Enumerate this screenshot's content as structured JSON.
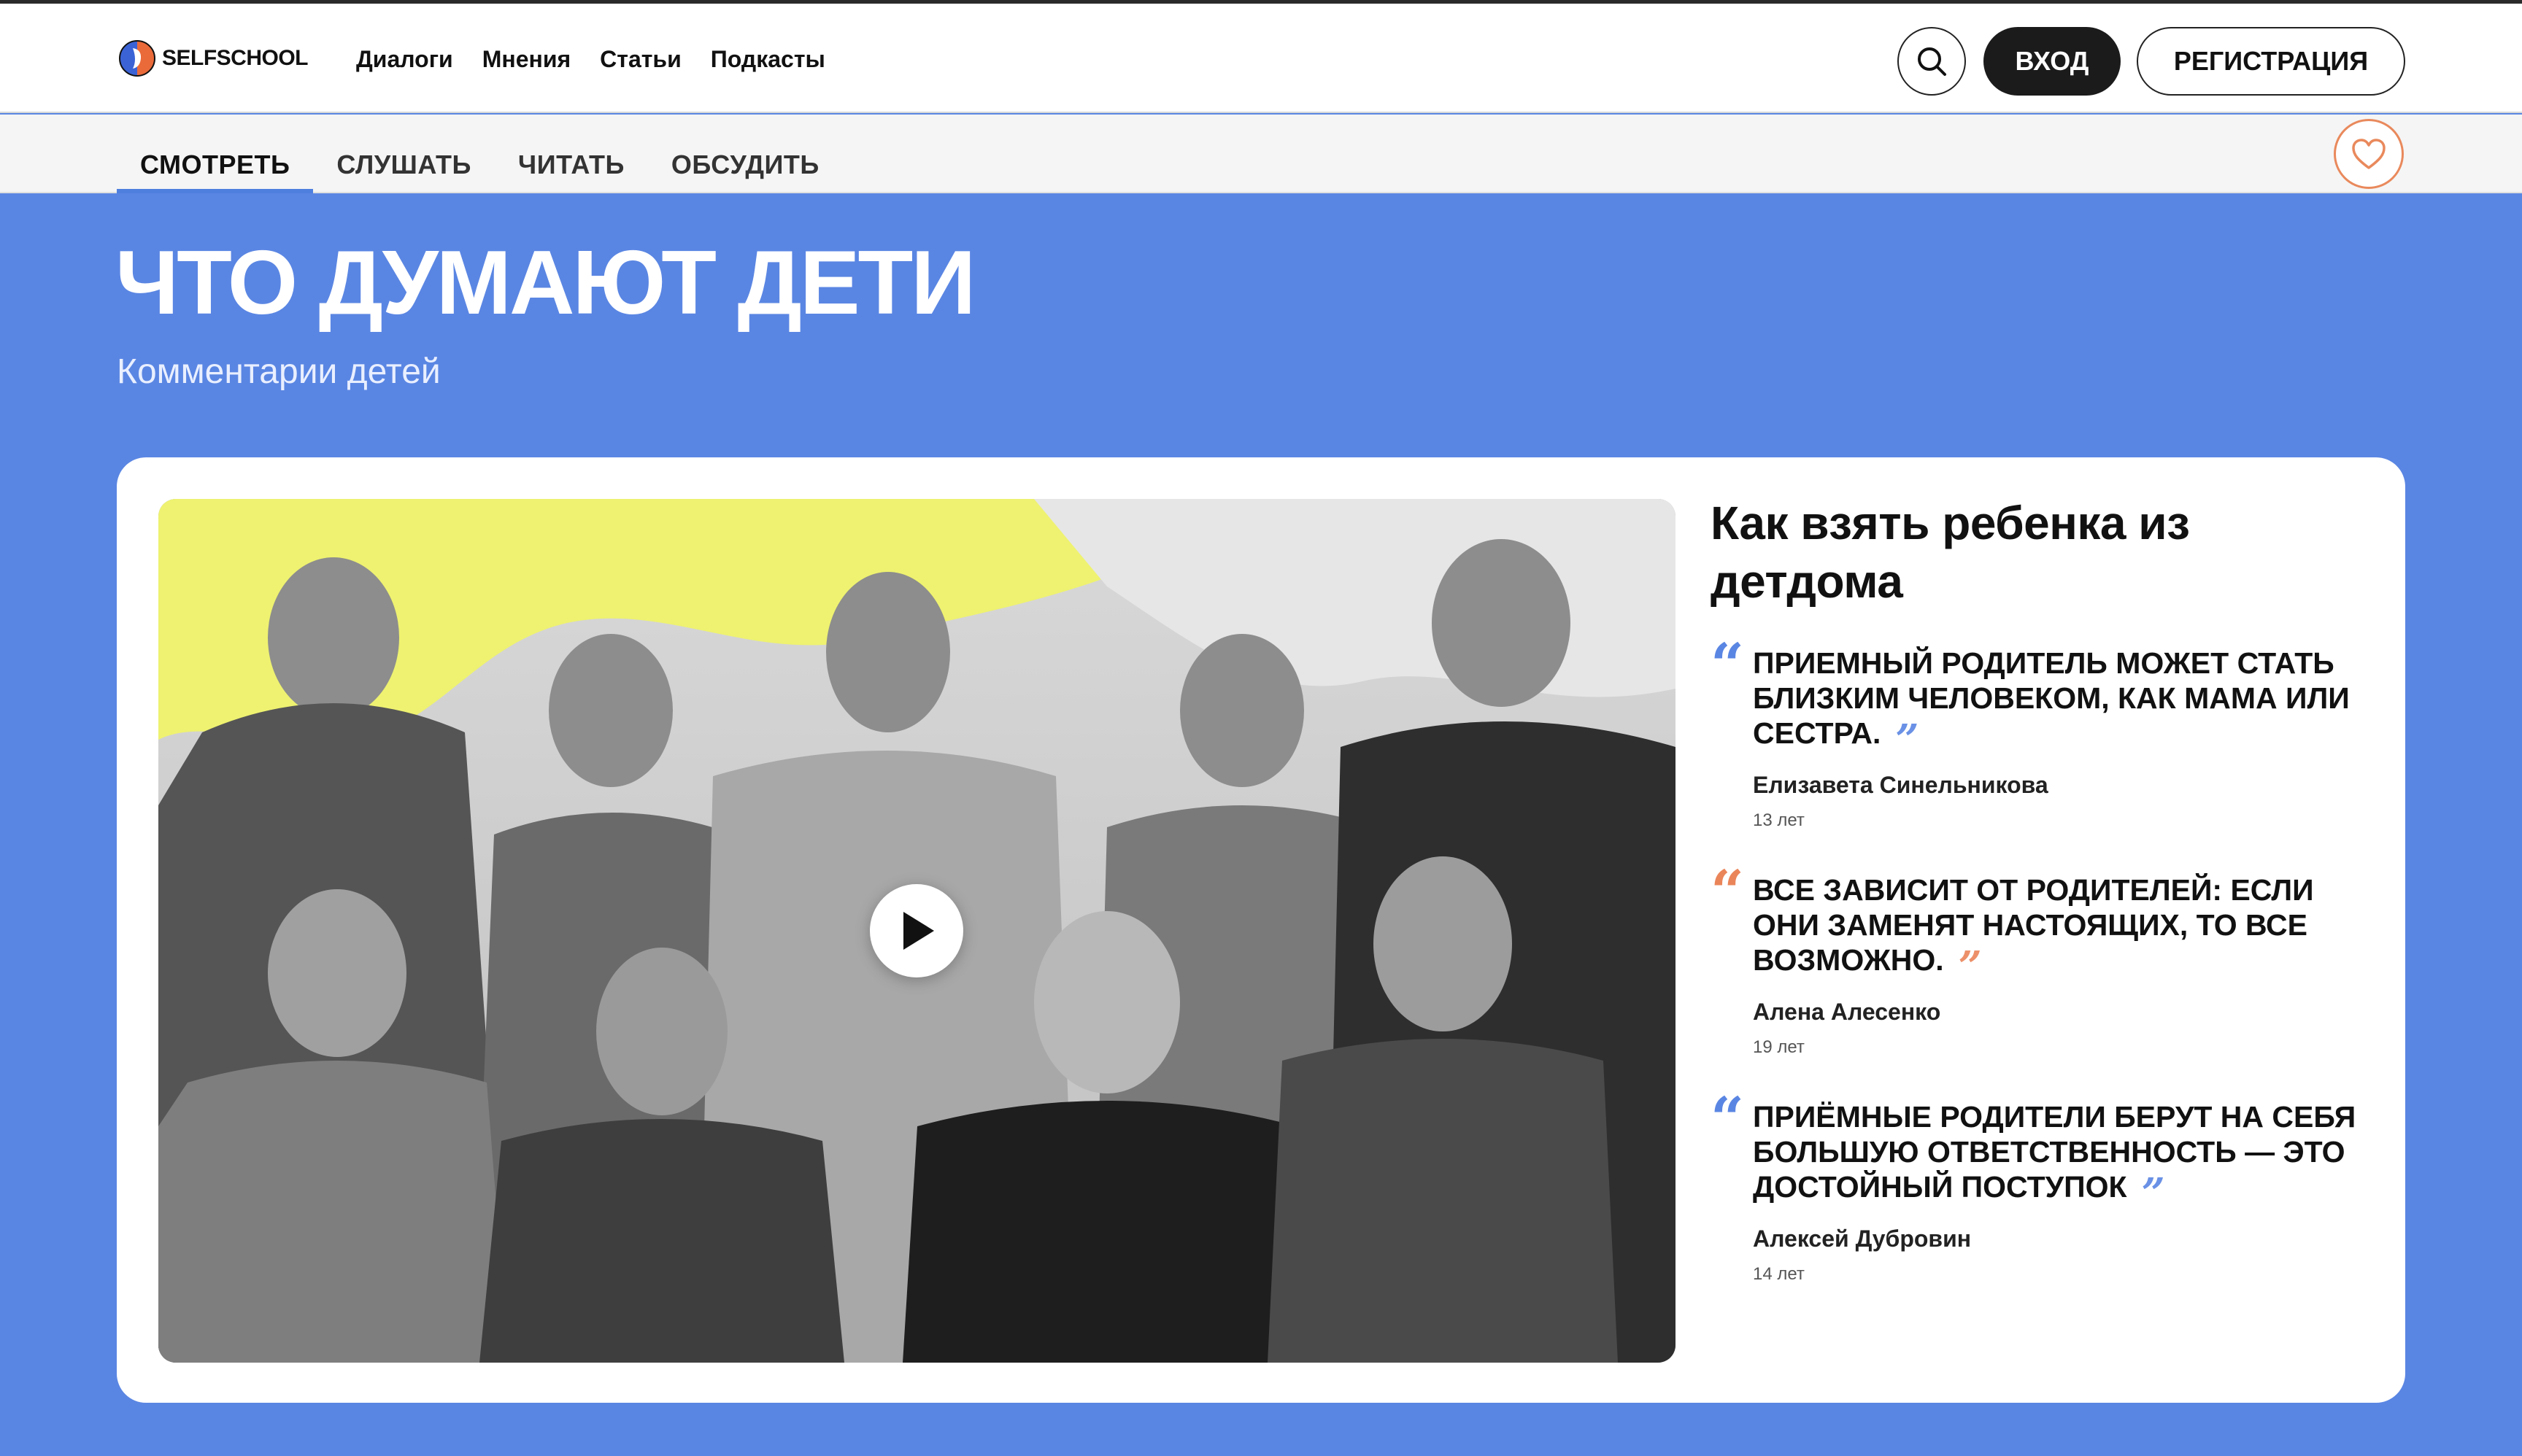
{
  "header": {
    "logo_text": "SELFSCHOOL",
    "nav": [
      "Диалоги",
      "Мнения",
      "Статьи",
      "Подкасты"
    ],
    "login_label": "ВХОД",
    "register_label": "РЕГИСТРАЦИЯ"
  },
  "subnav": {
    "tabs": [
      "СМОТРЕТЬ",
      "СЛУШАТЬ",
      "ЧИТАТЬ",
      "ОБСУДИТЬ"
    ],
    "active_tab": 0
  },
  "hero": {
    "title": "ЧТО ДУМАЮТ ДЕТИ",
    "subtitle": "Комментарии детей"
  },
  "card": {
    "title": "Как взять ребенка из детдома",
    "quotes": [
      {
        "text": "ПРИЕМНЫЙ РОДИТЕЛЬ МОЖЕТ СТАТЬ БЛИЗКИМ ЧЕЛОВЕКОМ, КАК МАМА ИЛИ СЕСТРА.",
        "author": "Елизавета Синельникова",
        "age": "13 лет",
        "accent": "#5a86e3"
      },
      {
        "text": "ВСЕ ЗАВИСИТ ОТ РОДИТЕЛЕЙ: ЕСЛИ ОНИ ЗАМЕНЯТ НАСТОЯЩИХ, ТО ВСЕ ВОЗМОЖНО.",
        "author": "Алена Алесенко",
        "age": "19 лет",
        "accent": "#ea855a"
      },
      {
        "text": "ПРИЁМНЫЕ РОДИТЕЛИ БЕРУТ НА СЕБЯ БОЛЬШУЮ ОТВЕТСТВЕННОСТЬ — ЭТО ДОСТОЙНЫЙ ПОСТУПОК",
        "author": "Алексей Дубровин",
        "age": "14 лет",
        "accent": "#5a86e3"
      }
    ]
  },
  "colors": {
    "page_bg": "#5a86e3",
    "accent_blue": "#4f7fde",
    "accent_orange": "#ea855a",
    "video_highlight": "#eef270"
  },
  "icons": {
    "search": "search-icon",
    "favorite": "heart-icon",
    "play": "play-icon",
    "logo": "selfschool-logo-icon",
    "quote_open": "quote-open-icon",
    "quote_close": "quote-close-icon"
  }
}
